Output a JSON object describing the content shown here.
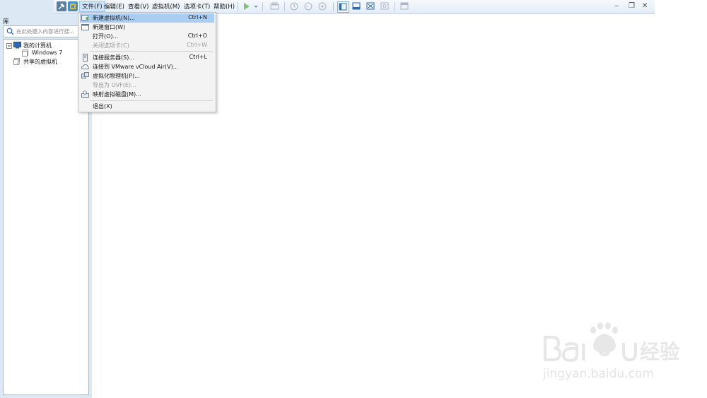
{
  "menubar": {
    "items": [
      "文件(F)",
      "编辑(E)",
      "查看(V)",
      "虚拟机(M)",
      "选项卡(T)",
      "帮助(H)"
    ],
    "active_index": 0
  },
  "sidebar": {
    "title": "库",
    "search_placeholder": "在此处键入内容进行搜...",
    "tree": [
      {
        "label": "我的计算机",
        "icon": "computer-icon",
        "level": 0
      },
      {
        "label": "Windows 7",
        "icon": "vm-icon",
        "level": 1
      },
      {
        "label": "共享的虚拟机",
        "icon": "shared-vm-icon",
        "level": 0
      }
    ]
  },
  "file_menu": {
    "items": [
      {
        "label": "新建虚拟机(N)...",
        "shortcut": "Ctrl+N",
        "icon": "new-vm-icon",
        "highlighted": true,
        "disabled": false
      },
      {
        "label": "新建窗口(W)",
        "shortcut": "",
        "icon": "new-window-icon",
        "highlighted": false,
        "disabled": false
      },
      {
        "label": "打开(O)...",
        "shortcut": "Ctrl+O",
        "icon": "",
        "highlighted": false,
        "disabled": false
      },
      {
        "label": "关闭选项卡(C)",
        "shortcut": "Ctrl+W",
        "icon": "",
        "highlighted": false,
        "disabled": true
      },
      {
        "label": "连接服务器(S)...",
        "shortcut": "Ctrl+L",
        "icon": "server-icon",
        "highlighted": false,
        "disabled": false
      },
      {
        "label": "连接到 VMware vCloud Air(V)...",
        "shortcut": "",
        "icon": "cloud-icon",
        "highlighted": false,
        "disabled": false
      },
      {
        "label": "虚拟化物理机(P)...",
        "shortcut": "",
        "icon": "physical-machine-icon",
        "highlighted": false,
        "disabled": false
      },
      {
        "label": "导出为 OVF(E)...",
        "shortcut": "",
        "icon": "",
        "highlighted": false,
        "disabled": true
      },
      {
        "label": "映射虚拟磁盘(M)...",
        "shortcut": "",
        "icon": "map-disk-icon",
        "highlighted": false,
        "disabled": false
      },
      {
        "label": "退出(X)",
        "shortcut": "",
        "icon": "",
        "highlighted": false,
        "disabled": false
      }
    ]
  },
  "watermark": {
    "text": "jingyan.baidu.com"
  },
  "colors": {
    "sidebar_bg": "#dde8f5",
    "menu_highlight": "#a9cdf3",
    "play_green": "#3aa935"
  }
}
